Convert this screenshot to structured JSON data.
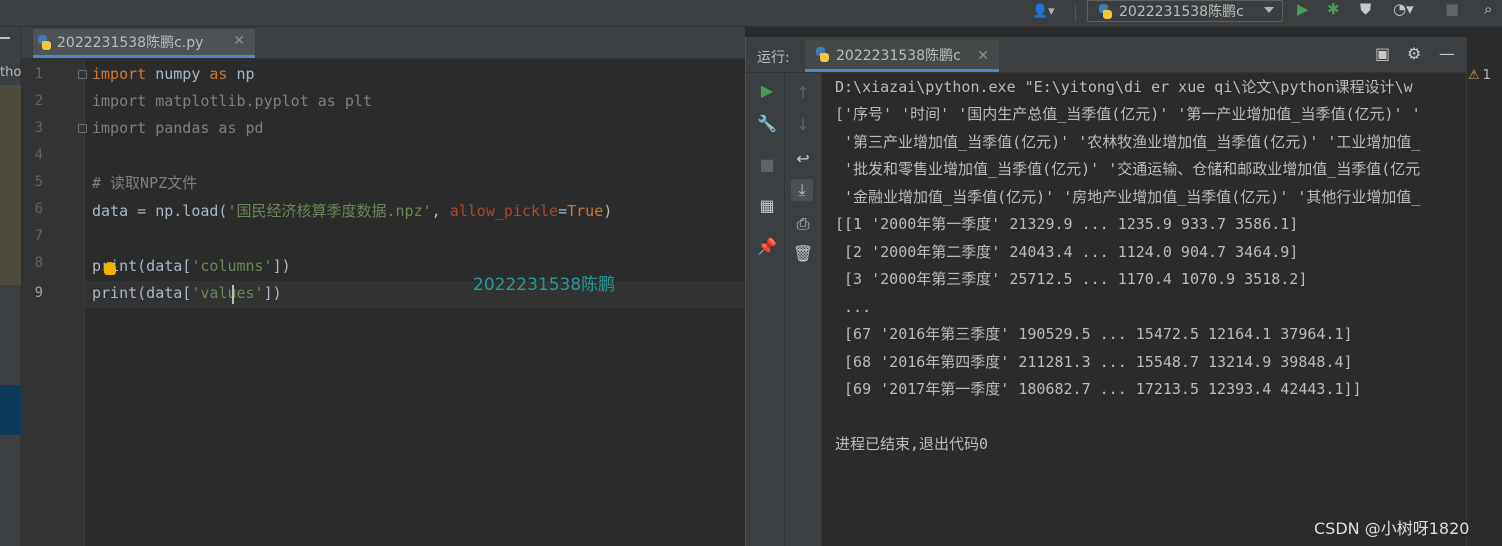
{
  "toolbar": {
    "user_icon": "user-icon",
    "run_config_label": "2022231538陈鹏c",
    "icons": [
      "run-icon",
      "debug-icon",
      "coverage-icon",
      "profile-icon",
      "stop-icon",
      "search-icon"
    ],
    "colors": {
      "run": "#499c54",
      "debug": "#499c54"
    }
  },
  "left_strip": {
    "fragment": "tho"
  },
  "editor": {
    "tab_label": "2022231538陈鹏c.py",
    "line_numbers": [
      "1",
      "2",
      "3",
      "4",
      "5",
      "6",
      "7",
      "8",
      "9"
    ],
    "current_line": "9",
    "watermark": "2022231538陈鹏",
    "lines": {
      "l1": {
        "kw": "import",
        "mod": " numpy ",
        "as": "as",
        "alias": " np"
      },
      "l2": "import matplotlib.pyplot as plt",
      "l3": "import pandas as pd",
      "l5": "# 读取NPZ文件",
      "l6": {
        "a": "data = np.load(",
        "str": "'国民经济核算季度数据.npz'",
        "b": ", ",
        "param": "allow_pickle",
        "eq": "=",
        "val": "True",
        "c": ")"
      },
      "l8": {
        "a": "print(data[",
        "str": "'columns'",
        "b": "])"
      },
      "l9": {
        "a": "print(data[",
        "str": "'values'",
        "b": "])"
      }
    }
  },
  "run_panel": {
    "label": "运行:",
    "tab_label": "2022231538陈鹏c",
    "console_lines": [
      "D:\\xiazai\\python.exe \"E:\\yitong\\di er xue qi\\论文\\python课程设计\\w",
      "['序号' '时间' '国内生产总值_当季值(亿元)' '第一产业增加值_当季值(亿元)' '",
      " '第三产业增加值_当季值(亿元)' '农林牧渔业增加值_当季值(亿元)' '工业增加值_",
      " '批发和零售业增加值_当季值(亿元)' '交通运输、仓储和邮政业增加值_当季值(亿元",
      " '金融业增加值_当季值(亿元)' '房地产业增加值_当季值(亿元)' '其他行业增加值_",
      "[[1 '2000年第一季度' 21329.9 ... 1235.9 933.7 3586.1]",
      " [2 '2000年第二季度' 24043.4 ... 1124.0 904.7 3464.9]",
      " [3 '2000年第三季度' 25712.5 ... 1170.4 1070.9 3518.2]",
      " ...",
      " [67 '2016年第三季度' 190529.5 ... 15472.5 12164.1 37964.1]",
      " [68 '2016年第四季度' 211281.3 ... 15548.7 13214.9 39848.4]",
      " [69 '2017年第一季度' 180682.7 ... 17213.5 12393.4 42443.1]]",
      "",
      "进程已结束,退出代码0"
    ],
    "warning_count": "1"
  },
  "footer": {
    "watermark": "CSDN @小树呀1820"
  }
}
